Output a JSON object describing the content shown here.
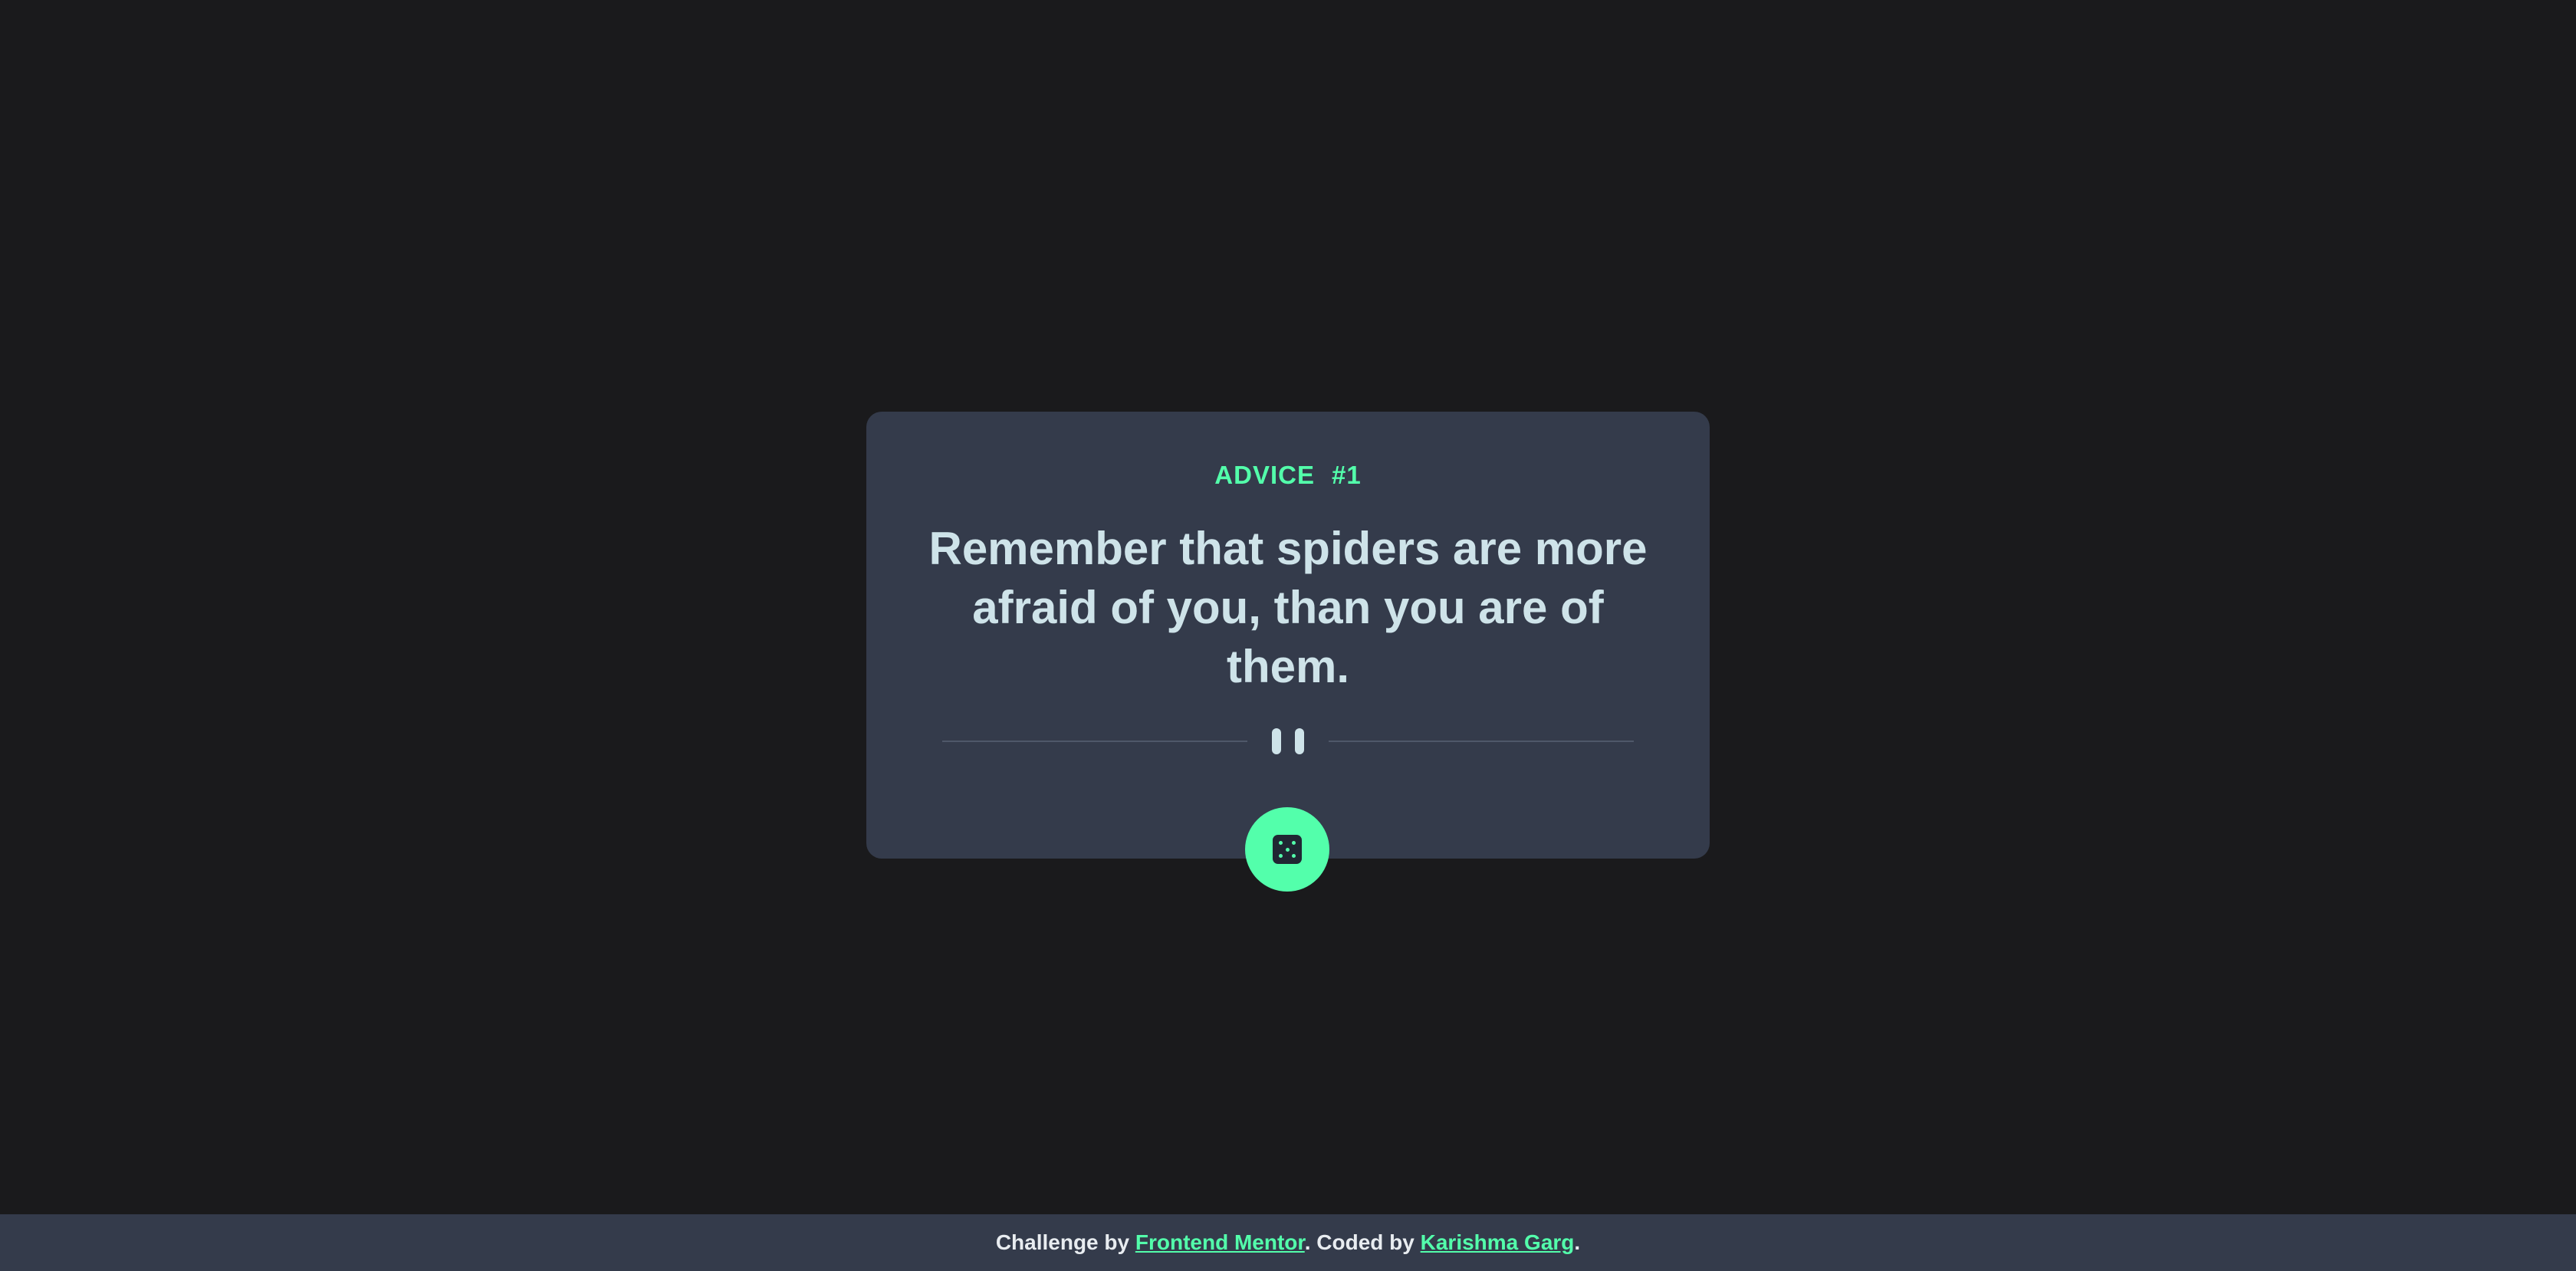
{
  "advice": {
    "label": "ADVICE",
    "number": "#1",
    "text": "Remember that spiders are more afraid of you, than you are of them."
  },
  "divider": {
    "icon": "pause-icon"
  },
  "dice_button": {
    "icon": "dice-icon"
  },
  "footer": {
    "prefix": "Challenge by ",
    "challenge_link": "Frontend Mentor",
    "middle": ". Coded by ",
    "author_link": "Karishma Garg",
    "suffix": "."
  },
  "colors": {
    "background": "#1a1a1c",
    "card": "#343b4b",
    "accent": "#53ffab",
    "text": "#cee3e9"
  }
}
